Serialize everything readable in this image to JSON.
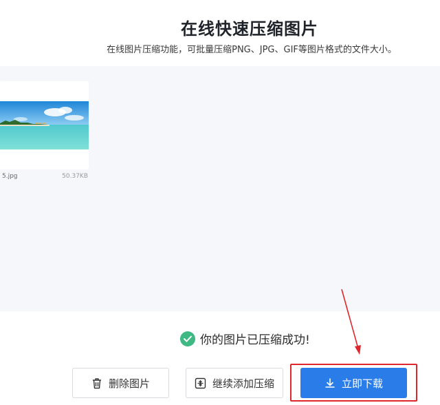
{
  "header": {
    "title": "在线快速压缩图片",
    "subtitle": "在线图片压缩功能，可批量压缩PNG、JPG、GIF等图片格式的文件大小。"
  },
  "files": [
    {
      "name": "5.jpg",
      "size": "50.37KB",
      "thumbnail": "beach-photo"
    }
  ],
  "status": {
    "message": "你的图片已压缩成功!",
    "icon": "check-circle-icon",
    "color": "#3fb984"
  },
  "actions": {
    "delete_label": "删除图片",
    "delete_icon": "trash-icon",
    "add_label": "继续添加压缩",
    "add_icon": "compress-add-icon",
    "download_label": "立即下载",
    "download_icon": "download-icon",
    "accent": "#2a7de9"
  },
  "annotation": {
    "color": "#e0262d",
    "target": "download-button"
  }
}
